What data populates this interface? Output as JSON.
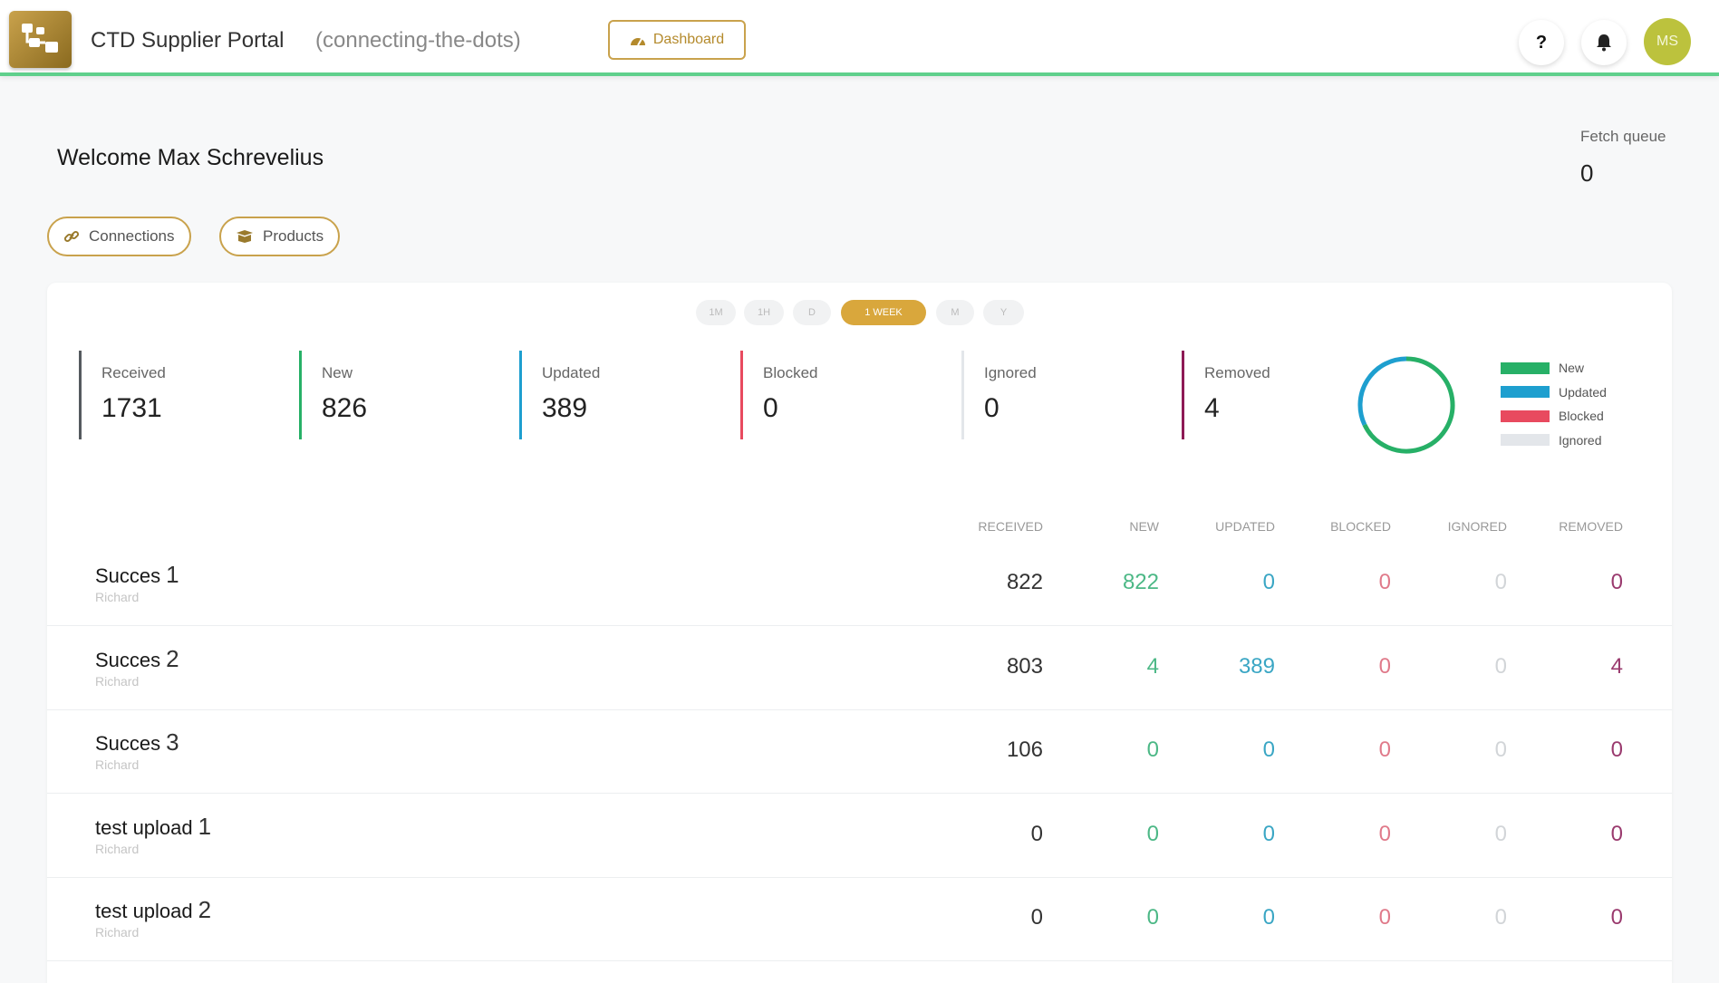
{
  "header": {
    "app_title": "CTD Supplier Portal",
    "app_subtitle": "(connecting-the-dots)",
    "dashboard_label": "Dashboard",
    "help_label": "?",
    "avatar_initials": "MS"
  },
  "welcome": {
    "text": "Welcome Max Schrevelius",
    "fetch_queue_label": "Fetch queue",
    "fetch_queue_value": "0"
  },
  "nav": {
    "connections_label": "Connections",
    "products_label": "Products"
  },
  "time_ranges": [
    "1M",
    "1H",
    "D",
    "1 WEEK",
    "M",
    "Y"
  ],
  "active_range": "1 WEEK",
  "stats": [
    {
      "label": "Received",
      "value": "1731",
      "color": "#555a5f"
    },
    {
      "label": "New",
      "value": "826",
      "color": "#27b067"
    },
    {
      "label": "Updated",
      "value": "389",
      "color": "#1e9fcf"
    },
    {
      "label": "Blocked",
      "value": "0",
      "color": "#e84a5f"
    },
    {
      "label": "Ignored",
      "value": "0",
      "color": "#e3e6ea"
    },
    {
      "label": "Removed",
      "value": "4",
      "color": "#8e1a55"
    }
  ],
  "legend": [
    {
      "label": "New",
      "color": "#27b067"
    },
    {
      "label": "Updated",
      "color": "#1e9fcf"
    },
    {
      "label": "Blocked",
      "color": "#e84a5f"
    },
    {
      "label": "Ignored",
      "color": "#e3e6ea"
    }
  ],
  "donut": {
    "new": 826,
    "updated": 389,
    "blocked": 0,
    "ignored": 0
  },
  "table": {
    "headers": [
      "RECEIVED",
      "NEW",
      "UPDATED",
      "BLOCKED",
      "IGNORED",
      "REMOVED"
    ],
    "rows": [
      {
        "name": "Succes",
        "num": "1",
        "sub": "Richard",
        "values": [
          "822",
          "822",
          "0",
          "0",
          "0",
          "0"
        ]
      },
      {
        "name": "Succes",
        "num": "2",
        "sub": "Richard",
        "values": [
          "803",
          "4",
          "389",
          "0",
          "0",
          "4"
        ]
      },
      {
        "name": "Succes",
        "num": "3",
        "sub": "Richard",
        "values": [
          "106",
          "0",
          "0",
          "0",
          "0",
          "0"
        ]
      },
      {
        "name": "test upload",
        "num": "1",
        "sub": "Richard",
        "values": [
          "0",
          "0",
          "0",
          "0",
          "0",
          "0"
        ]
      },
      {
        "name": "test upload",
        "num": "2",
        "sub": "Richard",
        "values": [
          "0",
          "0",
          "0",
          "0",
          "0",
          "0"
        ]
      }
    ],
    "value_colors": [
      "#333333",
      "#4cb886",
      "#3aa6c4",
      "#e07a8a",
      "#d2d5d8",
      "#9a3a6e"
    ]
  }
}
